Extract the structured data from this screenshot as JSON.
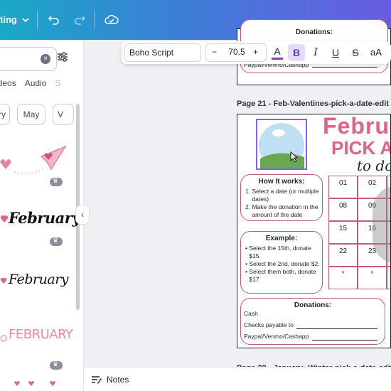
{
  "topbar": {
    "editing_label": "ting",
    "colors": {
      "gradient_start": "#1aa8c6",
      "gradient_end": "#6a5ce0"
    },
    "icons": [
      "chevron-down-icon",
      "undo-icon",
      "redo-icon",
      "cloud-save-icon"
    ]
  },
  "sidepanel": {
    "tabs": [
      "ideos",
      "Audio",
      "S"
    ],
    "chips": [
      "ry",
      "May",
      "V"
    ],
    "items": [
      {
        "label": ""
      },
      {
        "label": "February"
      },
      {
        "label": "February"
      },
      {
        "label": "FEBRUARY"
      }
    ]
  },
  "toolbar": {
    "font_name": "Boho Script",
    "minus": "−",
    "font_size": "70.5",
    "plus": "+",
    "text_color": "A",
    "bold": "B",
    "italic": "I",
    "underline": "U",
    "strike": "S",
    "case": "aA"
  },
  "page_top": {
    "donations_title": "Donations:",
    "paypal_line": "Paypal/Venmo/Cashapp"
  },
  "page21": {
    "label": "Page 21 - Feb-Valentines-pick-a-date-edit",
    "title_line1": "Febru",
    "title_line2": "PICK A",
    "title_line3": "to do",
    "how_title": "How It works:",
    "how_steps": [
      "Select a date (or multiple dates)",
      "Make the donation in the amount of the date"
    ],
    "example_title": "Example:",
    "example_items": [
      "Select the 15th, donate $15.",
      "Select the 2nd, donate $2.",
      "Select them both, donate $17"
    ],
    "grid": [
      [
        "01",
        "02"
      ],
      [
        "08",
        "09"
      ],
      [
        "15",
        "16"
      ],
      [
        "22",
        "23"
      ],
      [
        "*",
        "*"
      ]
    ],
    "donations_title": "Donations:",
    "cash": "Cash",
    "checks": "Checks payable to",
    "paypal": "Paypal/Venmo/Cashapp"
  },
  "page22_label": "Page 22 - January- Winter-pick-a-date-edit",
  "bottombar": {
    "notes_label": "Notes"
  },
  "accent": {
    "pink": "#e0638a",
    "border_pink": "#c25a7a",
    "purple": "#8b5cf6"
  }
}
